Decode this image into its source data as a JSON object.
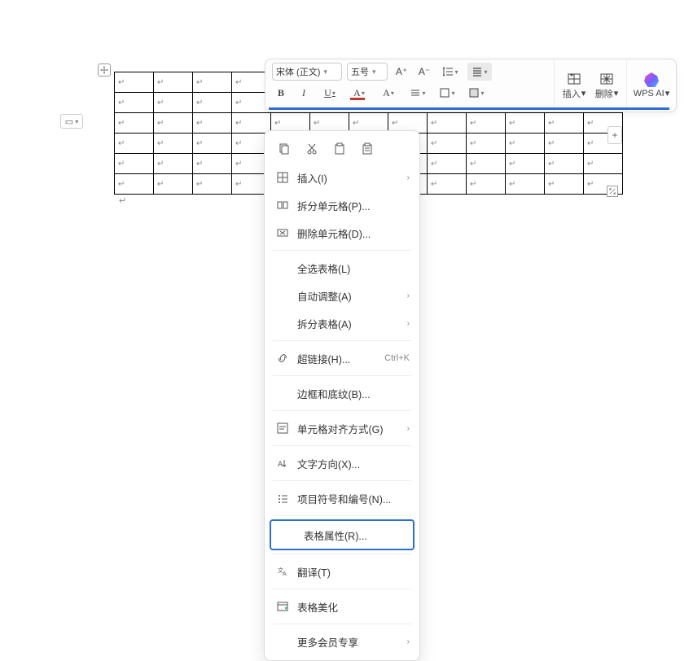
{
  "paragraph_mark": "↵",
  "toolbar": {
    "font": {
      "value": "宋体 (正文)"
    },
    "size": {
      "value": "五号"
    },
    "buttons": {
      "incfont": "A⁺",
      "decfont": "A⁻",
      "bold": "B",
      "italic": "I",
      "underline": "U"
    },
    "font_color": "#c0392b",
    "highlight_color": "#2e6bd6",
    "insert_label": "插入",
    "delete_label": "删除",
    "ai_label": "WPS AI"
  },
  "context_menu": {
    "items": [
      {
        "key": "insert",
        "label": "插入(I)",
        "arrow": true,
        "icon": "grid"
      },
      {
        "key": "split-cell",
        "label": "拆分单元格(P)...",
        "icon": "split"
      },
      {
        "key": "delete-cell",
        "label": "删除单元格(D)...",
        "icon": "delcell"
      },
      {
        "sep": true
      },
      {
        "key": "select-table",
        "label": "全选表格(L)",
        "noicon": true
      },
      {
        "key": "autofit",
        "label": "自动调整(A)",
        "noicon": true,
        "arrow": true
      },
      {
        "key": "split-table",
        "label": "拆分表格(A)",
        "noicon": true,
        "arrow": true
      },
      {
        "sep": true
      },
      {
        "key": "hyperlink",
        "label": "超链接(H)...",
        "icon": "link",
        "shortcut": "Ctrl+K"
      },
      {
        "sep": true
      },
      {
        "key": "borders",
        "label": "边框和底纹(B)...",
        "noicon": true
      },
      {
        "sep": true
      },
      {
        "key": "cell-align",
        "label": "单元格对齐方式(G)",
        "icon": "cellalign",
        "arrow": true
      },
      {
        "sep": true
      },
      {
        "key": "text-dir",
        "label": "文字方向(X)...",
        "icon": "textdir"
      },
      {
        "sep": true
      },
      {
        "key": "bullets",
        "label": "项目符号和编号(N)...",
        "icon": "bullets"
      },
      {
        "sep": true
      },
      {
        "key": "table-props",
        "label": "表格属性(R)...",
        "noicon": true,
        "highlight": true
      },
      {
        "sep": true
      },
      {
        "key": "translate",
        "label": "翻译(T)",
        "icon": "translate"
      },
      {
        "sep": true
      },
      {
        "key": "beautify",
        "label": "表格美化",
        "icon": "beautify"
      },
      {
        "sep": true
      },
      {
        "key": "premium",
        "label": "更多会员专享",
        "noicon": true,
        "arrow": true
      }
    ]
  },
  "table": {
    "rows": 6,
    "cols": 13
  }
}
